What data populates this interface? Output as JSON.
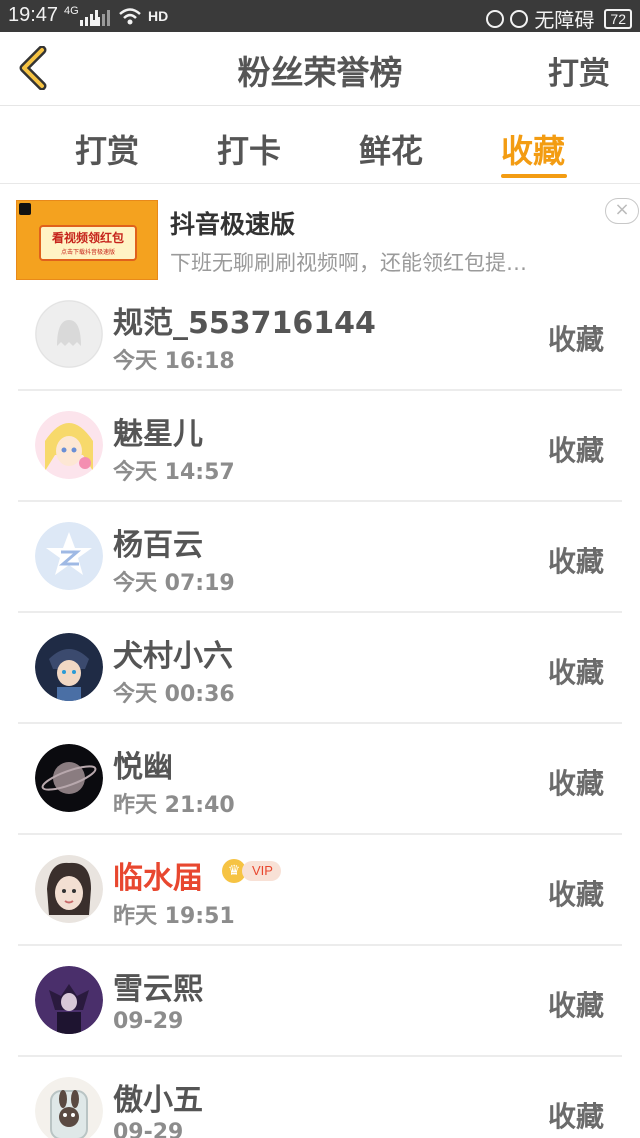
{
  "status_bar": {
    "time": "19:47",
    "signal_labels": [
      "4G",
      "HD"
    ],
    "accessibility": "无障碍",
    "battery": "72"
  },
  "header": {
    "title": "粉丝荣誉榜",
    "action": "打赏",
    "back_icon": "chevron-left-icon"
  },
  "tabs": [
    {
      "label": "打赏",
      "active": false
    },
    {
      "label": "打卡",
      "active": false
    },
    {
      "label": "鲜花",
      "active": false
    },
    {
      "label": "收藏",
      "active": true
    }
  ],
  "ad": {
    "thumb_text": "看视频领红包",
    "thumb_sub": "点击下载抖音极速版",
    "title": "抖音极速版",
    "description": "下班无聊刷刷视频啊，还能领红包提…",
    "close": "×"
  },
  "colors": {
    "accent": "#f39c12",
    "vip_name": "#e8472f"
  },
  "users": [
    {
      "name": "规范_553716144",
      "time": "今天 16:18",
      "action": "收藏",
      "vip": false,
      "avatar": "default-avatar"
    },
    {
      "name": "魅星儿",
      "time": "今天 14:57",
      "action": "收藏",
      "vip": false,
      "avatar": "anime-girl-avatar"
    },
    {
      "name": "杨百云",
      "time": "今天 07:19",
      "action": "收藏",
      "vip": false,
      "avatar": "qzone-avatar"
    },
    {
      "name": "犬村小六",
      "time": "今天 00:36",
      "action": "收藏",
      "vip": false,
      "avatar": "anime-boy-avatar"
    },
    {
      "name": "悦幽",
      "time": "昨天 21:40",
      "action": "收藏",
      "vip": false,
      "avatar": "planet-avatar"
    },
    {
      "name": "临水届",
      "time": "昨天 19:51",
      "action": "收藏",
      "vip": true,
      "vip_label": "VIP",
      "avatar": "photo-avatar"
    },
    {
      "name": "雪云熙",
      "time": "09-29",
      "action": "收藏",
      "vip": false,
      "avatar": "purple-avatar"
    },
    {
      "name": "傲小五",
      "time": "09-29",
      "action": "收藏",
      "vip": false,
      "avatar": "bunny-jar-avatar"
    }
  ]
}
